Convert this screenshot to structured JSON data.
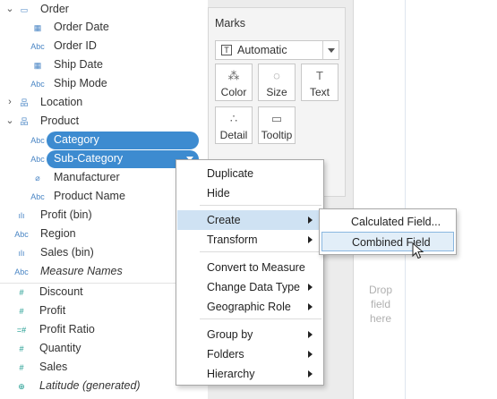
{
  "data_pane": {
    "fields": [
      {
        "label": "Order",
        "icon": "folder-icon",
        "glyph": "▭",
        "chevron": "⌄",
        "kind": "folder"
      },
      {
        "label": "Order Date",
        "icon": "calendar-icon",
        "glyph": "▦",
        "kind": "dim"
      },
      {
        "label": "Order ID",
        "icon": "abc-icon",
        "glyph": "Abc",
        "kind": "dim"
      },
      {
        "label": "Ship Date",
        "icon": "calendar-icon",
        "glyph": "▦",
        "kind": "dim"
      },
      {
        "label": "Ship Mode",
        "icon": "abc-icon",
        "glyph": "Abc",
        "kind": "dim"
      },
      {
        "label": "Location",
        "icon": "hierarchy-icon",
        "glyph": "品",
        "chevron": "›",
        "kind": "dim"
      },
      {
        "label": "Product",
        "icon": "hierarchy-icon",
        "glyph": "品",
        "chevron": "⌄",
        "kind": "dim"
      },
      {
        "label": "Category",
        "icon": "abc-icon",
        "glyph": "Abc",
        "kind": "dim",
        "selected": true
      },
      {
        "label": "Sub-Category",
        "icon": "abc-icon",
        "glyph": "Abc",
        "kind": "dim",
        "selected": true
      },
      {
        "label": "Manufacturer",
        "icon": "paperclip-icon",
        "glyph": "⌀",
        "kind": "dim"
      },
      {
        "label": "Product Name",
        "icon": "abc-icon",
        "glyph": "Abc",
        "kind": "dim"
      },
      {
        "label": "Profit (bin)",
        "icon": "bin-icon",
        "glyph": "ılı",
        "kind": "dim"
      },
      {
        "label": "Region",
        "icon": "abc-icon",
        "glyph": "Abc",
        "kind": "dim"
      },
      {
        "label": "Sales (bin)",
        "icon": "bin-icon",
        "glyph": "ılı",
        "kind": "dim"
      },
      {
        "label": "Measure Names",
        "icon": "abc-icon",
        "glyph": "Abc",
        "kind": "dim",
        "italic": true
      },
      {
        "label": "Discount",
        "icon": "number-icon",
        "glyph": "#",
        "kind": "meas"
      },
      {
        "label": "Profit",
        "icon": "number-icon",
        "glyph": "#",
        "kind": "meas"
      },
      {
        "label": "Profit Ratio",
        "icon": "calc-number-icon",
        "glyph": "=#",
        "kind": "meas"
      },
      {
        "label": "Quantity",
        "icon": "number-icon",
        "glyph": "#",
        "kind": "meas"
      },
      {
        "label": "Sales",
        "icon": "number-icon",
        "glyph": "#",
        "kind": "meas"
      },
      {
        "label": "Latitude (generated)",
        "icon": "globe-icon",
        "glyph": "⊕",
        "kind": "meas",
        "italic": true
      }
    ]
  },
  "marks": {
    "title": "Marks",
    "type_label": "Automatic",
    "type_glyph": "T",
    "buttons": [
      {
        "label": "Color",
        "glyph": "⁂",
        "icon": "color-icon"
      },
      {
        "label": "Size",
        "glyph": "◌",
        "icon": "size-icon"
      },
      {
        "label": "Text",
        "glyph": "T",
        "icon": "text-icon"
      },
      {
        "label": "Detail",
        "glyph": "∴",
        "icon": "detail-icon"
      },
      {
        "label": "Tooltip",
        "glyph": "▭",
        "icon": "tooltip-icon"
      }
    ]
  },
  "view": {
    "drop_text": "Drop field here"
  },
  "context_menu": {
    "items": [
      {
        "label": "Duplicate"
      },
      {
        "label": "Hide"
      },
      {
        "label": "Create",
        "submenu": true,
        "highlighted": true
      },
      {
        "label": "Transform",
        "submenu": true
      },
      {
        "label": "Convert to Measure"
      },
      {
        "label": "Change Data Type",
        "submenu": true
      },
      {
        "label": "Geographic Role",
        "submenu": true
      },
      {
        "label": "Group by",
        "submenu": true
      },
      {
        "label": "Folders",
        "submenu": true
      },
      {
        "label": "Hierarchy",
        "submenu": true
      }
    ]
  },
  "create_submenu": {
    "items": [
      {
        "label": "Calculated Field..."
      },
      {
        "label": "Combined Field",
        "highlighted": true
      }
    ]
  },
  "colors": {
    "selection_pill": "#3d8bd0",
    "dimension_icon": "#4a86c5",
    "measure_icon": "#1a9a8e",
    "menu_highlight": "#cfe2f3"
  }
}
